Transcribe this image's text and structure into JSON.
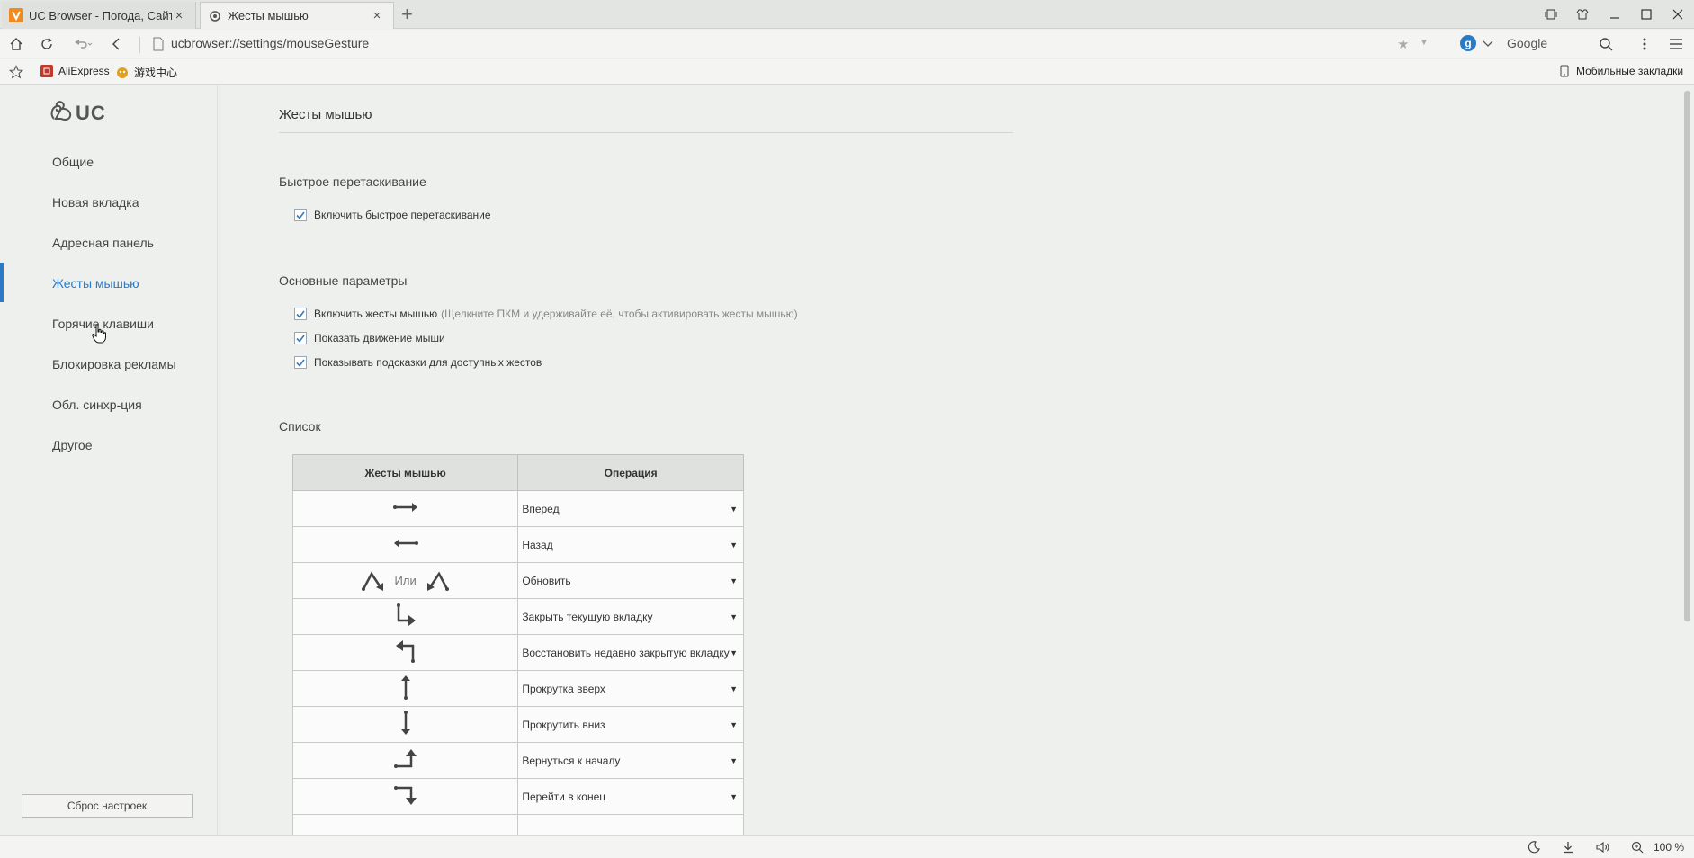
{
  "tabs": [
    {
      "title": "UC Browser - Погода, Сайт, Н"
    },
    {
      "title": "Жесты мышью"
    }
  ],
  "toolbar": {
    "url": "ucbrowser://settings/mouseGesture",
    "search_engine": "Google"
  },
  "bookmarks": [
    {
      "label": "AliExpress",
      "color": "#c0392b"
    },
    {
      "label": "游戏中心",
      "color": "#e0a020"
    }
  ],
  "mobile_bookmarks": "Мобильные закладки",
  "sidebar": {
    "logo": "UC",
    "items": [
      {
        "label": "Общие"
      },
      {
        "label": "Новая вкладка"
      },
      {
        "label": "Адресная панель"
      },
      {
        "label": "Жесты мышью"
      },
      {
        "label": "Горячие клавиши"
      },
      {
        "label": "Блокировка рекламы"
      },
      {
        "label": "Обл. синхр-ция"
      },
      {
        "label": "Другое"
      }
    ],
    "reset_label": "Сброс настроек"
  },
  "main": {
    "title": "Жесты мышью",
    "quick_drag": {
      "title": "Быстрое перетаскивание",
      "option": "Включить быстрое перетаскивание"
    },
    "basic": {
      "title": "Основные параметры",
      "opt1": "Включить жесты мышью",
      "opt1_hint": "(Щелкните ПКМ и удерживайте её, чтобы активировать жесты мышью)",
      "opt2": "Показать движение мыши",
      "opt3": "Показывать подсказки для доступных жестов"
    },
    "list": {
      "title": "Список",
      "col_gesture": "Жесты мышью",
      "col_operation": "Операция",
      "or_text": "Или",
      "rows": [
        {
          "gesture": "arrow-right-icon",
          "operation": "Вперед"
        },
        {
          "gesture": "arrow-left-icon",
          "operation": "Назад"
        },
        {
          "gesture": "up-down-icon",
          "operation": "Обновить"
        },
        {
          "gesture": "down-right-icon",
          "operation": "Закрыть текущую вкладку"
        },
        {
          "gesture": "up-left-icon",
          "operation": "Восстановить недавно закрытую вкладку"
        },
        {
          "gesture": "arrow-up-icon",
          "operation": "Прокрутка вверх"
        },
        {
          "gesture": "arrow-down-icon",
          "operation": "Прокрутить вниз"
        },
        {
          "gesture": "right-up-icon",
          "operation": "Вернуться к началу"
        },
        {
          "gesture": "right-down-icon",
          "operation": "Перейти в конец"
        }
      ]
    }
  },
  "status": {
    "zoom": "100 %"
  }
}
